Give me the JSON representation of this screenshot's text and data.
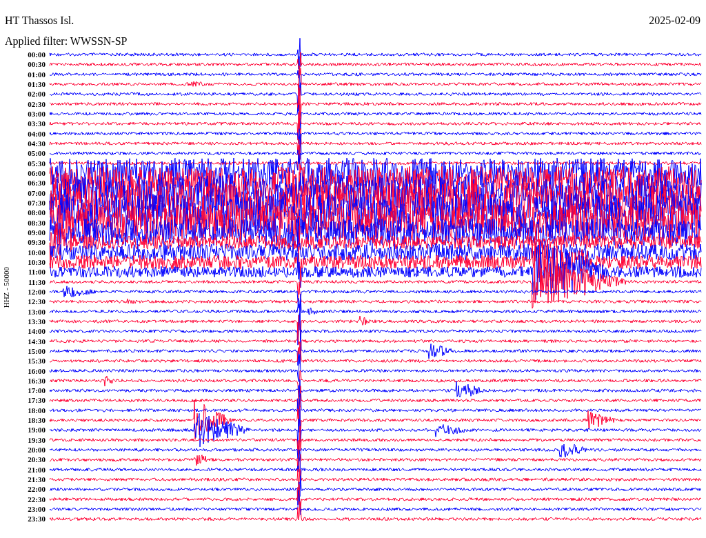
{
  "header": {
    "station": "HT Thassos Isl.",
    "date": "2025-02-09",
    "filter": "Applied filter: WWSSN-SP"
  },
  "plot": {
    "axis_label": "HHZ - 50000",
    "traces": [
      {
        "time": "00:00",
        "color": "#0000ff"
      },
      {
        "time": "00:30",
        "color": "#ff0033"
      },
      {
        "time": "01:00",
        "color": "#0000ff"
      },
      {
        "time": "01:30",
        "color": "#ff0033"
      },
      {
        "time": "02:00",
        "color": "#0000ff"
      },
      {
        "time": "02:30",
        "color": "#ff0033"
      },
      {
        "time": "03:00",
        "color": "#0000ff"
      },
      {
        "time": "03:30",
        "color": "#ff0033"
      },
      {
        "time": "04:00",
        "color": "#0000ff"
      },
      {
        "time": "04:30",
        "color": "#ff0033"
      },
      {
        "time": "05:00",
        "color": "#0000ff"
      },
      {
        "time": "05:30",
        "color": "#ff0033"
      },
      {
        "time": "06:00",
        "color": "#0000ff"
      },
      {
        "time": "06:30",
        "color": "#ff0033"
      },
      {
        "time": "07:00",
        "color": "#0000ff"
      },
      {
        "time": "07:30",
        "color": "#ff0033"
      },
      {
        "time": "08:00",
        "color": "#0000ff"
      },
      {
        "time": "08:30",
        "color": "#ff0033"
      },
      {
        "time": "09:00",
        "color": "#0000ff"
      },
      {
        "time": "09:30",
        "color": "#ff0033"
      },
      {
        "time": "10:00",
        "color": "#0000ff"
      },
      {
        "time": "10:30",
        "color": "#ff0033"
      },
      {
        "time": "11:00",
        "color": "#0000ff"
      },
      {
        "time": "11:30",
        "color": "#ff0033"
      },
      {
        "time": "12:00",
        "color": "#0000ff"
      },
      {
        "time": "12:30",
        "color": "#ff0033"
      },
      {
        "time": "13:00",
        "color": "#0000ff"
      },
      {
        "time": "13:30",
        "color": "#ff0033"
      },
      {
        "time": "14:00",
        "color": "#0000ff"
      },
      {
        "time": "14:30",
        "color": "#ff0033"
      },
      {
        "time": "15:00",
        "color": "#0000ff"
      },
      {
        "time": "15:30",
        "color": "#ff0033"
      },
      {
        "time": "16:00",
        "color": "#0000ff"
      },
      {
        "time": "16:30",
        "color": "#ff0033"
      },
      {
        "time": "17:00",
        "color": "#0000ff"
      },
      {
        "time": "17:30",
        "color": "#ff0033"
      },
      {
        "time": "18:00",
        "color": "#0000ff"
      },
      {
        "time": "18:30",
        "color": "#ff0033"
      },
      {
        "time": "19:00",
        "color": "#0000ff"
      },
      {
        "time": "19:30",
        "color": "#ff0033"
      },
      {
        "time": "20:00",
        "color": "#0000ff"
      },
      {
        "time": "20:30",
        "color": "#ff0033"
      },
      {
        "time": "21:00",
        "color": "#0000ff"
      },
      {
        "time": "21:30",
        "color": "#ff0033"
      },
      {
        "time": "22:00",
        "color": "#0000ff"
      },
      {
        "time": "22:30",
        "color": "#ff0033"
      },
      {
        "time": "23:00",
        "color": "#0000ff"
      },
      {
        "time": "23:30",
        "color": "#ff0033"
      }
    ]
  }
}
